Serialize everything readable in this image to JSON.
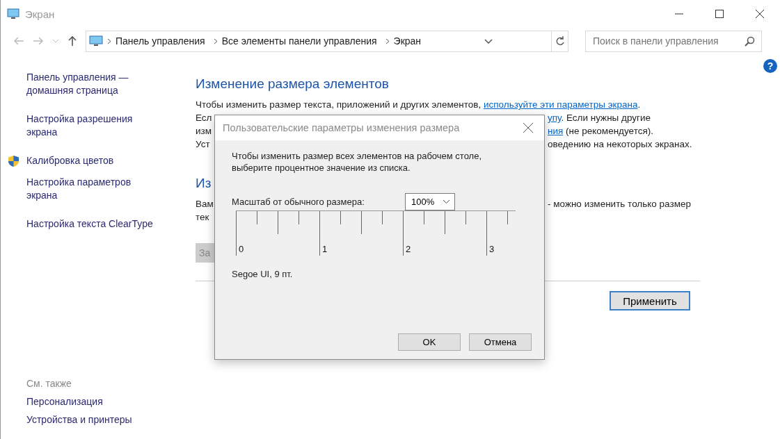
{
  "window": {
    "title": "Экран"
  },
  "address_bar": {
    "breadcrumbs": [
      "Панель управления",
      "Все элементы панели управления",
      "Экран"
    ]
  },
  "search": {
    "placeholder": "Поиск в панели управления"
  },
  "sidebar": {
    "links": [
      {
        "label": "Панель управления — домашняя страница",
        "kind": "home"
      },
      {
        "label": "Настройка разрешения экрана",
        "kind": "plain"
      },
      {
        "label": "Калибровка цветов",
        "kind": "shield"
      },
      {
        "label": "Настройка параметров экрана",
        "kind": "plain"
      },
      {
        "label": "Настройка текста ClearType",
        "kind": "plain"
      }
    ],
    "see_also": {
      "title": "См. также",
      "links": [
        "Персонализация",
        "Устройства и принтеры"
      ]
    }
  },
  "main": {
    "sections": [
      {
        "heading": "Изменение размера элементов",
        "lines": [
          {
            "left": [
              {
                "kind": "text",
                "text": "Чтобы изменить размер текста, приложений и других элементов, "
              },
              {
                "kind": "link",
                "text": "используйте эти параметры экрана"
              },
              {
                "kind": "text",
                "text": "."
              }
            ]
          },
          {
            "left": [
              {
                "kind": "text",
                "text": "Есл"
              }
            ],
            "right": [
              {
                "kind": "link",
                "text": "упу"
              },
              {
                "kind": "text",
                "text": ". Если нужны другие"
              }
            ]
          },
          {
            "left": [
              {
                "kind": "text",
                "text": "изм"
              }
            ],
            "right": [
              {
                "kind": "link",
                "text": "ния"
              },
              {
                "kind": "text",
                "text": " (не рекомендуется)."
              }
            ]
          },
          {
            "left": [
              {
                "kind": "text",
                "text": "Уст"
              }
            ],
            "right": [
              {
                "kind": "text",
                "text": "оведению на некоторых экранах."
              }
            ]
          }
        ]
      },
      {
        "heading": "Из",
        "lines": [
          {
            "left": [
              {
                "kind": "text",
                "text": "Вам"
              }
            ],
            "right": [
              {
                "kind": "text",
                "text": "- можно изменить только размер"
              }
            ]
          },
          {
            "left": [
              {
                "kind": "text",
                "text": "тек"
              }
            ]
          }
        ],
        "button": {
          "label": "За",
          "disabled": true
        }
      }
    ],
    "apply_button": "Применить"
  },
  "help_button": "?",
  "dialog": {
    "title": "Пользовательские параметры изменения размера",
    "description": "Чтобы изменить размер всех элементов на рабочем столе, выберите процентное значение из списка.",
    "scale_label": "Масштаб от обычного размера:",
    "scale_value": "100%",
    "ruler_labels": [
      "0",
      "1",
      "2",
      "3"
    ],
    "font_sample": "Segoe UI, 9 пт.",
    "buttons": [
      {
        "label": "OK",
        "default": false
      },
      {
        "label": "Отмена",
        "default": false
      }
    ]
  }
}
